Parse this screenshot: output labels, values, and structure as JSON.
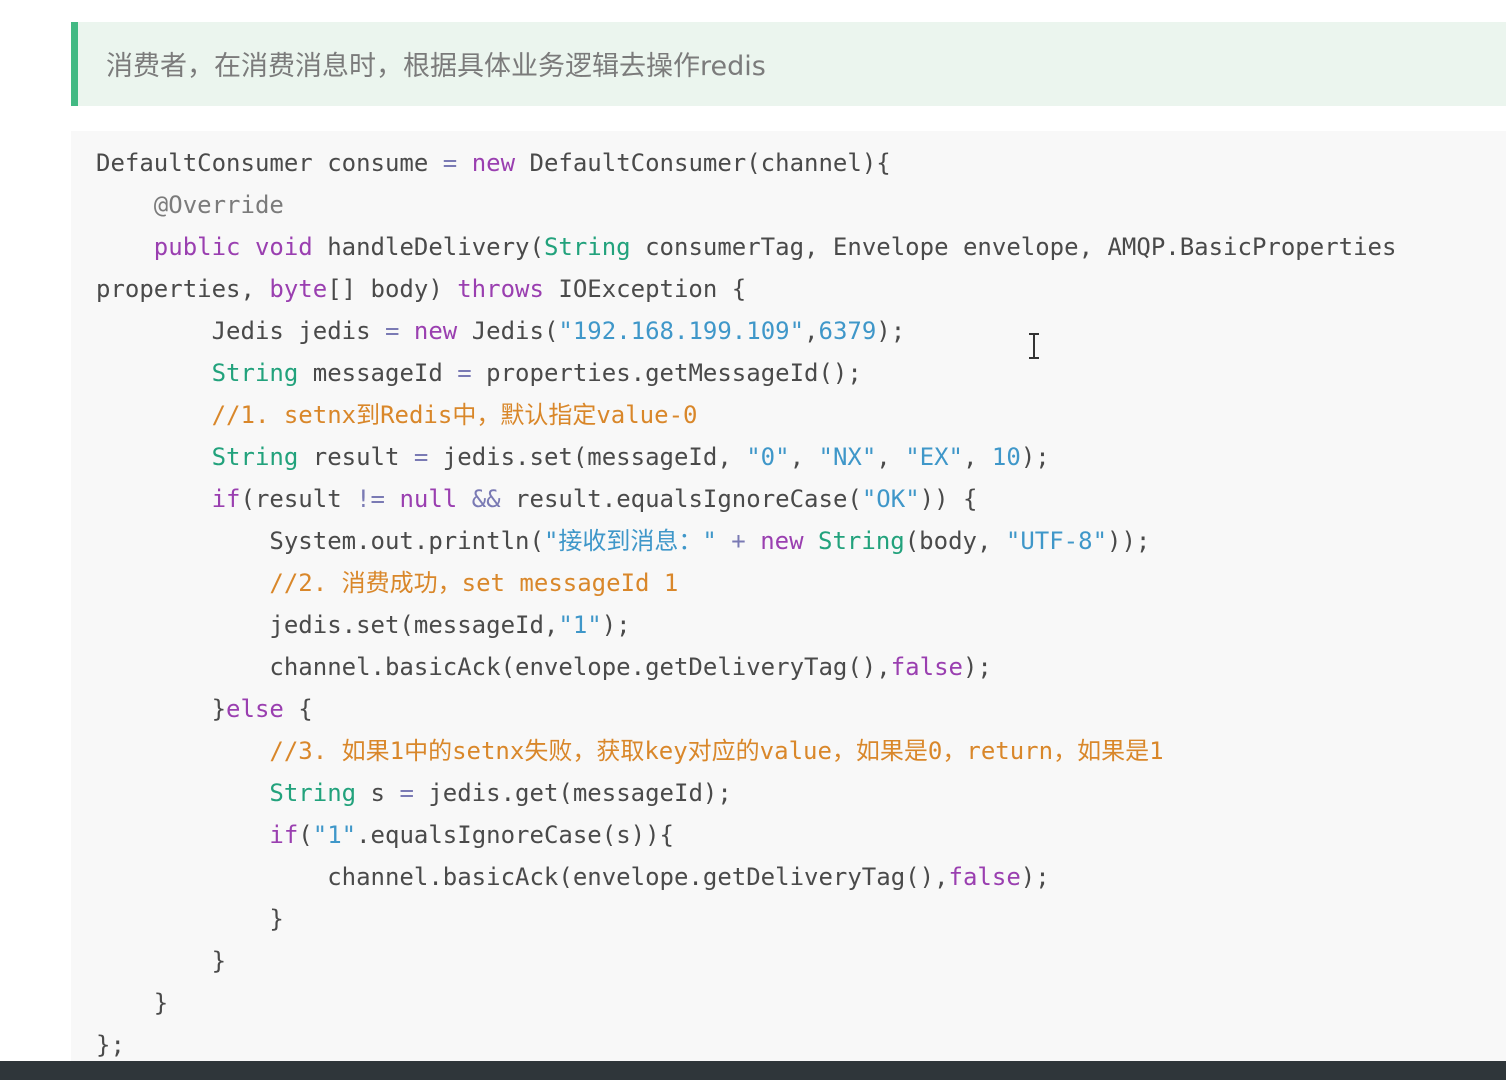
{
  "tip": {
    "text": "消费者，在消费消息时，根据具体业务逻辑去操作redis"
  },
  "code": {
    "lines": [
      [
        [
          "txt",
          "DefaultConsumer consume "
        ],
        [
          "op",
          "="
        ],
        [
          "txt",
          " "
        ],
        [
          "kw",
          "new"
        ],
        [
          "txt",
          " DefaultConsumer(channel){"
        ]
      ],
      [
        [
          "txt",
          "    "
        ],
        [
          "ann",
          "@Override"
        ]
      ],
      [
        [
          "txt",
          "    "
        ],
        [
          "kw",
          "public"
        ],
        [
          "txt",
          " "
        ],
        [
          "kw",
          "void"
        ],
        [
          "txt",
          " handleDelivery("
        ],
        [
          "type",
          "String"
        ],
        [
          "txt",
          " consumerTag, Envelope envelope, AMQP.BasicProperties"
        ]
      ],
      [
        [
          "txt",
          "properties, "
        ],
        [
          "kw",
          "byte"
        ],
        [
          "txt",
          "[] body) "
        ],
        [
          "kw",
          "throws"
        ],
        [
          "txt",
          " IOException {"
        ]
      ],
      [
        [
          "txt",
          "        Jedis jedis "
        ],
        [
          "op",
          "="
        ],
        [
          "txt",
          " "
        ],
        [
          "kw",
          "new"
        ],
        [
          "txt",
          " Jedis("
        ],
        [
          "str",
          "\"192.168.199.109\""
        ],
        [
          "txt",
          ","
        ],
        [
          "num",
          "6379"
        ],
        [
          "txt",
          ");"
        ]
      ],
      [
        [
          "txt",
          "        "
        ],
        [
          "type",
          "String"
        ],
        [
          "txt",
          " messageId "
        ],
        [
          "op",
          "="
        ],
        [
          "txt",
          " properties.getMessageId();"
        ]
      ],
      [
        [
          "txt",
          "        "
        ],
        [
          "cm",
          "//1. setnx到Redis中，默认指定value-0"
        ]
      ],
      [
        [
          "txt",
          "        "
        ],
        [
          "type",
          "String"
        ],
        [
          "txt",
          " result "
        ],
        [
          "op",
          "="
        ],
        [
          "txt",
          " jedis.set(messageId, "
        ],
        [
          "str",
          "\"0\""
        ],
        [
          "txt",
          ", "
        ],
        [
          "str",
          "\"NX\""
        ],
        [
          "txt",
          ", "
        ],
        [
          "str",
          "\"EX\""
        ],
        [
          "txt",
          ", "
        ],
        [
          "num",
          "10"
        ],
        [
          "txt",
          ");"
        ]
      ],
      [
        [
          "txt",
          "        "
        ],
        [
          "kw",
          "if"
        ],
        [
          "txt",
          "(result "
        ],
        [
          "op",
          "!="
        ],
        [
          "txt",
          " "
        ],
        [
          "kw",
          "null"
        ],
        [
          "txt",
          " "
        ],
        [
          "op",
          "&&"
        ],
        [
          "txt",
          " result.equalsIgnoreCase("
        ],
        [
          "str",
          "\"OK\""
        ],
        [
          "txt",
          ")) {"
        ]
      ],
      [
        [
          "txt",
          "            System.out.println("
        ],
        [
          "str",
          "\"接收到消息：\""
        ],
        [
          "txt",
          " "
        ],
        [
          "op",
          "+"
        ],
        [
          "txt",
          " "
        ],
        [
          "kw",
          "new"
        ],
        [
          "txt",
          " "
        ],
        [
          "type",
          "String"
        ],
        [
          "txt",
          "(body, "
        ],
        [
          "str",
          "\"UTF-8\""
        ],
        [
          "txt",
          "));"
        ]
      ],
      [
        [
          "txt",
          "            "
        ],
        [
          "cm",
          "//2. 消费成功，set messageId 1"
        ]
      ],
      [
        [
          "txt",
          "            jedis.set(messageId,"
        ],
        [
          "str",
          "\"1\""
        ],
        [
          "txt",
          ");"
        ]
      ],
      [
        [
          "txt",
          "            channel.basicAck(envelope.getDeliveryTag(),"
        ],
        [
          "kw",
          "false"
        ],
        [
          "txt",
          ");"
        ]
      ],
      [
        [
          "txt",
          "        }"
        ],
        [
          "kw",
          "else"
        ],
        [
          "txt",
          " {"
        ]
      ],
      [
        [
          "txt",
          "            "
        ],
        [
          "cm",
          "//3. 如果1中的setnx失败，获取key对应的value，如果是0，return，如果是1"
        ]
      ],
      [
        [
          "txt",
          "            "
        ],
        [
          "type",
          "String"
        ],
        [
          "txt",
          " s "
        ],
        [
          "op",
          "="
        ],
        [
          "txt",
          " jedis.get(messageId);"
        ]
      ],
      [
        [
          "txt",
          "            "
        ],
        [
          "kw",
          "if"
        ],
        [
          "txt",
          "("
        ],
        [
          "str",
          "\"1\""
        ],
        [
          "txt",
          ".equalsIgnoreCase(s)){"
        ]
      ],
      [
        [
          "txt",
          "                channel.basicAck(envelope.getDeliveryTag(),"
        ],
        [
          "kw",
          "false"
        ],
        [
          "txt",
          ");"
        ]
      ],
      [
        [
          "txt",
          "            }"
        ]
      ],
      [
        [
          "txt",
          "        }"
        ]
      ],
      [
        [
          "txt",
          "    }"
        ]
      ],
      [
        [
          "txt",
          "};"
        ]
      ]
    ]
  },
  "colors": {
    "tip_background": "#ebf5ee",
    "tip_border": "#42b983",
    "code_background": "#f8f8f8",
    "keyword": "#9a3fb0",
    "type": "#22a27c",
    "string": "#3f97c9",
    "comment": "#d9872a"
  },
  "icons": {
    "cursor": "text-cursor-icon"
  }
}
